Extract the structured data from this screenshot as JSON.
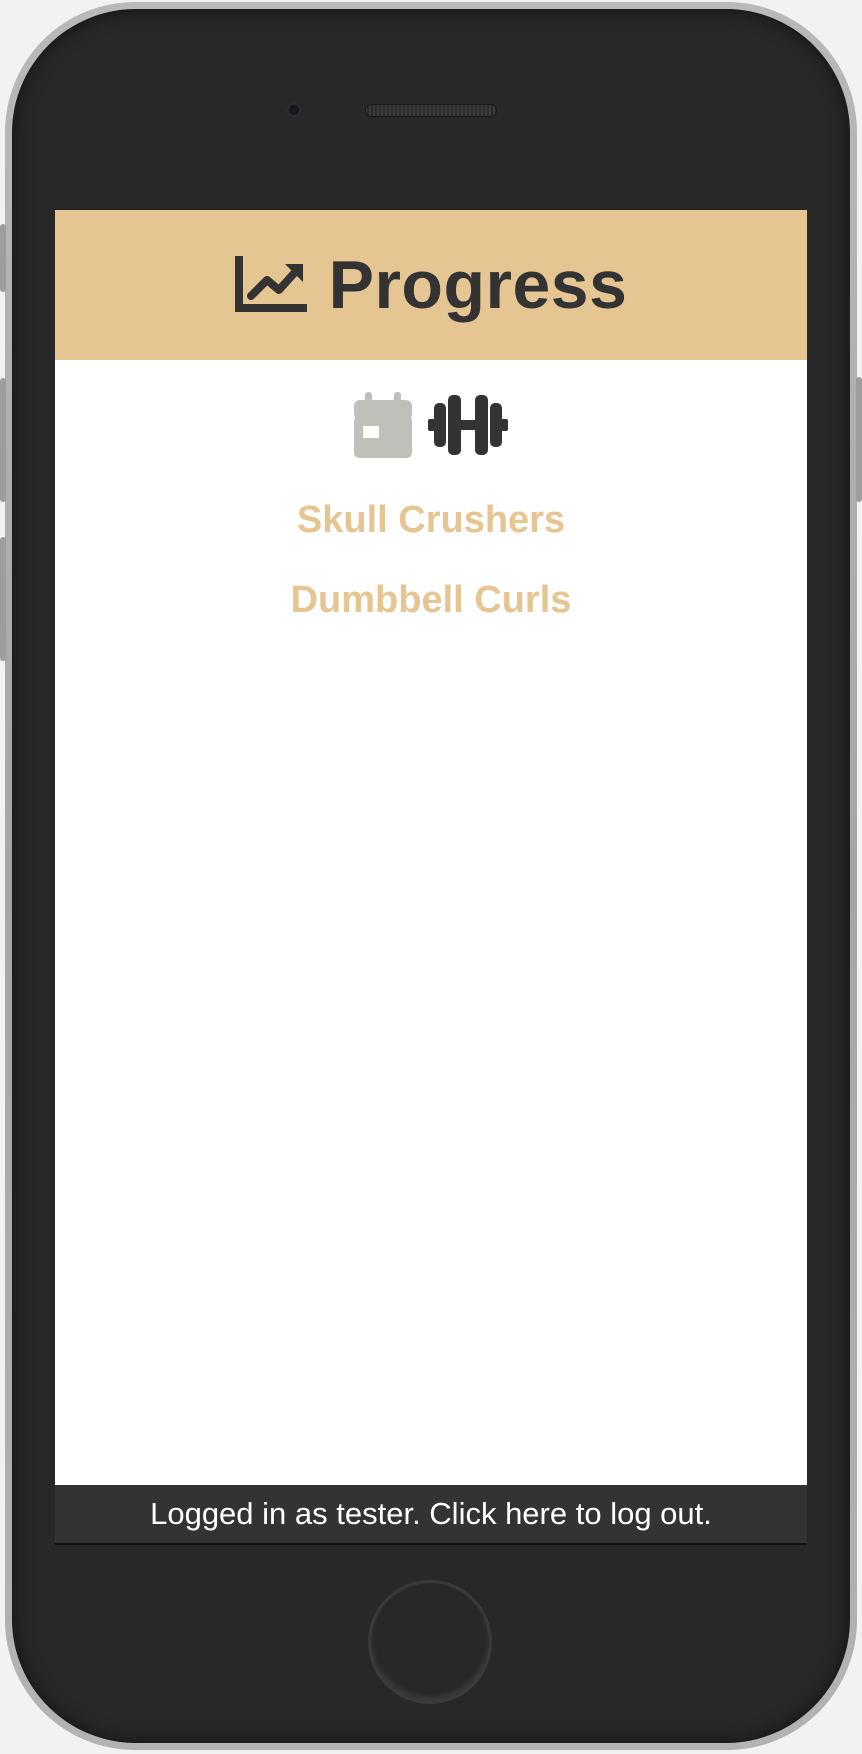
{
  "header": {
    "icon": "chart-line-icon",
    "title": "Progress"
  },
  "nav": {
    "items": [
      {
        "icon": "calendar-icon",
        "active": false
      },
      {
        "icon": "dumbbell-icon",
        "active": true
      }
    ]
  },
  "exercises": [
    {
      "label": "Skull Crushers"
    },
    {
      "label": "Dumbbell Curls"
    }
  ],
  "footer": {
    "text": "Logged in as tester. Click here to log out."
  },
  "colors": {
    "accent": "#e5c592",
    "dark": "#333333",
    "inactive_icon": "#c0c0bb"
  }
}
